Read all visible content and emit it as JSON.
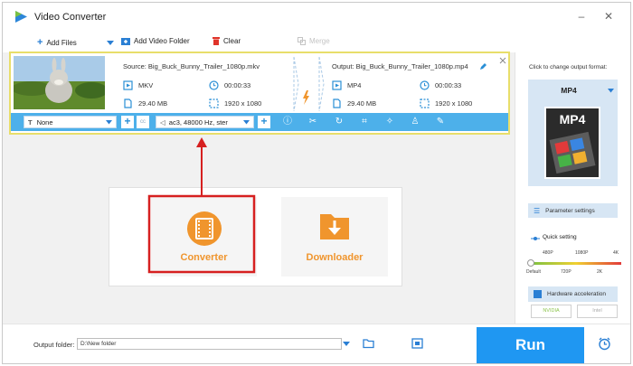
{
  "window": {
    "title": "Video Converter",
    "minimize_glyph": "–",
    "close_glyph": "✕"
  },
  "toolbar": {
    "add_files": "Add Files",
    "add_video_folder": "Add Video Folder",
    "clear": "Clear",
    "merge": "Merge"
  },
  "task": {
    "source": {
      "filename": "Source: Big_Buck_Bunny_Trailer_1080p.mkv",
      "format": "MKV",
      "duration": "00:00:33",
      "size": "29.40 MB",
      "resolution": "1920 x 1080"
    },
    "output": {
      "filename": "Output: Big_Buck_Bunny_Trailer_1080p.mp4",
      "format": "MP4",
      "duration": "00:00:33",
      "size": "29.40 MB",
      "resolution": "1920 x 1080"
    },
    "subtitle_select": "None",
    "audio_select": "ac3, 48000 Hz, ster",
    "cc_label": "cc"
  },
  "modes": {
    "converter": "Converter",
    "downloader": "Downloader"
  },
  "output_folder": {
    "label": "Output folder:",
    "value": "D:\\New folder"
  },
  "run_label": "Run",
  "side": {
    "title": "Click to change output format:",
    "format_name": "MP4",
    "format_logo": "MP4",
    "parameter_settings": "Parameter settings",
    "quick_setting": "Quick setting",
    "quality_top": [
      "480P",
      "1080P",
      "4K"
    ],
    "quality_bottom": [
      "Default",
      "720P",
      "2K"
    ],
    "hardware_acceleration": "Hardware acceleration",
    "nvidia": "NVIDIA",
    "intel": "Intel"
  },
  "colors": {
    "accent": "#1f97f2",
    "highlight_red": "#d62020",
    "orange": "#f0952d",
    "edit_bar": "#4db0ea"
  }
}
